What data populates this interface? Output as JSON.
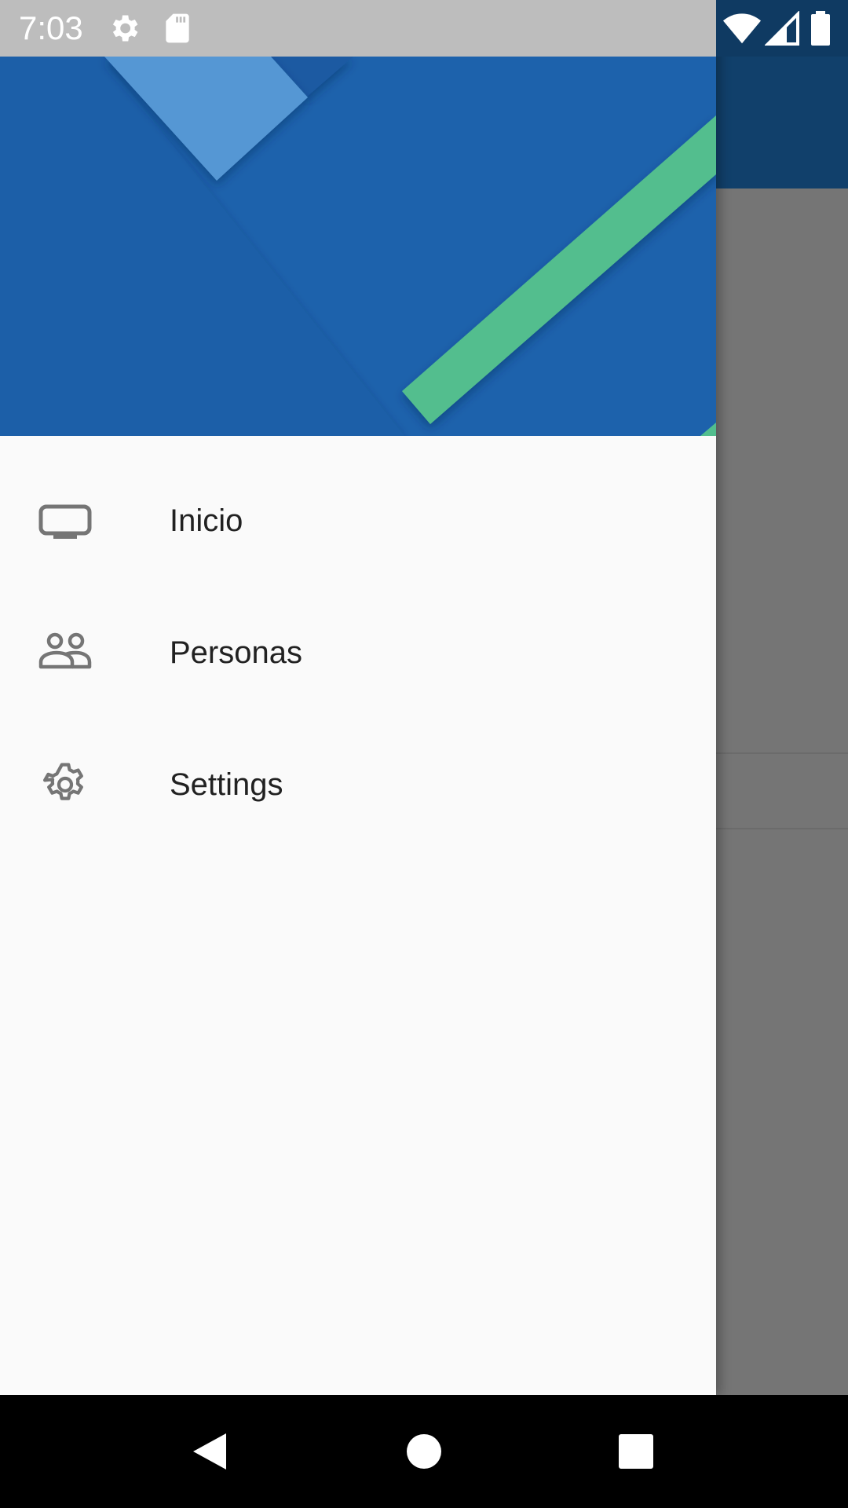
{
  "status_bar": {
    "time": "7:03",
    "left_icons": [
      "gear-icon",
      "sd-card-icon"
    ],
    "right_icons": [
      "wifi-icon",
      "cell-signal-icon",
      "battery-icon"
    ]
  },
  "drawer": {
    "menu_items": [
      {
        "label": "Inicio",
        "icon": "tv-icon"
      },
      {
        "label": "Personas",
        "icon": "people-icon"
      },
      {
        "label": "Settings",
        "icon": "settings-gear-icon"
      }
    ]
  },
  "nav_bar": {
    "buttons": [
      "back-icon",
      "home-icon",
      "recents-icon"
    ]
  },
  "colors": {
    "header_blue": "#1e63ad",
    "header_light_blue": "#5597d4",
    "header_green": "#52be8e",
    "drawer_bg": "#fafafa",
    "app_bar": "#11406b",
    "scrim": "#757575"
  }
}
